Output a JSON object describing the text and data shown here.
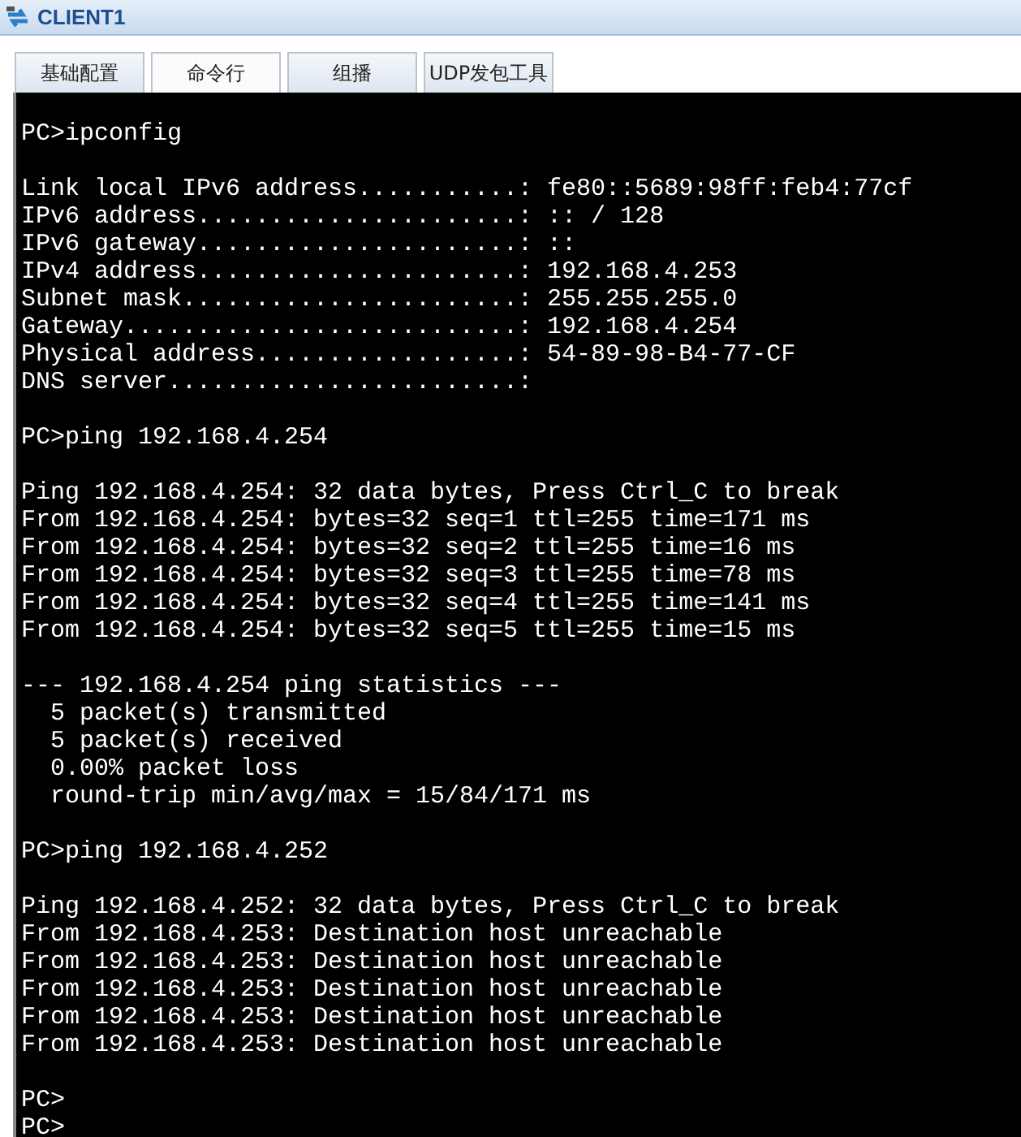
{
  "window": {
    "title": "CLIENT1"
  },
  "tabs": [
    {
      "label": "基础配置",
      "selected": false
    },
    {
      "label": "命令行",
      "selected": true
    },
    {
      "label": "组播",
      "selected": false
    },
    {
      "label": "UDP发包工具",
      "selected": false
    }
  ],
  "console": {
    "blocks": [
      [
        "PC>ipconfig"
      ],
      [
        "Link local IPv6 address...........: fe80::5689:98ff:feb4:77cf",
        "IPv6 address......................: :: / 128",
        "IPv6 gateway......................: ::",
        "IPv4 address......................: 192.168.4.253",
        "Subnet mask.......................: 255.255.255.0",
        "Gateway...........................: 192.168.4.254",
        "Physical address..................: 54-89-98-B4-77-CF",
        "DNS server........................:"
      ],
      [
        "PC>ping 192.168.4.254"
      ],
      [
        "Ping 192.168.4.254: 32 data bytes, Press Ctrl_C to break",
        "From 192.168.4.254: bytes=32 seq=1 ttl=255 time=171 ms",
        "From 192.168.4.254: bytes=32 seq=2 ttl=255 time=16 ms",
        "From 192.168.4.254: bytes=32 seq=3 ttl=255 time=78 ms",
        "From 192.168.4.254: bytes=32 seq=4 ttl=255 time=141 ms",
        "From 192.168.4.254: bytes=32 seq=5 ttl=255 time=15 ms"
      ],
      [
        "--- 192.168.4.254 ping statistics ---",
        "  5 packet(s) transmitted",
        "  5 packet(s) received",
        "  0.00% packet loss",
        "  round-trip min/avg/max = 15/84/171 ms"
      ],
      [
        "PC>ping 192.168.4.252"
      ],
      [
        "Ping 192.168.4.252: 32 data bytes, Press Ctrl_C to break",
        "From 192.168.4.253: Destination host unreachable",
        "From 192.168.4.253: Destination host unreachable",
        "From 192.168.4.253: Destination host unreachable",
        "From 192.168.4.253: Destination host unreachable",
        "From 192.168.4.253: Destination host unreachable"
      ],
      [
        "PC>",
        "PC>"
      ]
    ]
  }
}
